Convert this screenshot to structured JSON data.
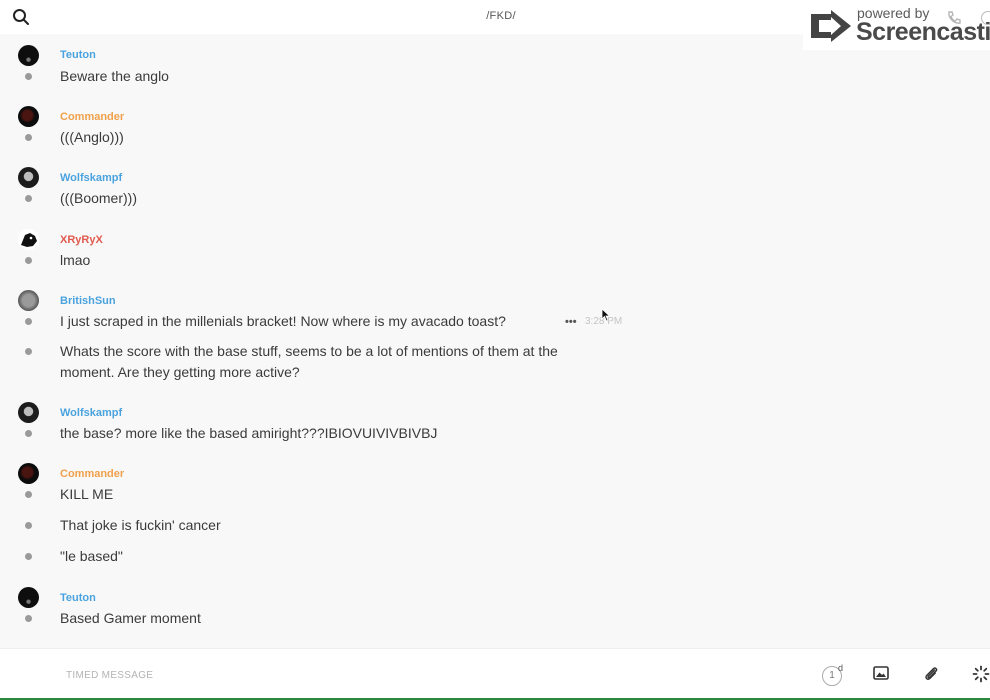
{
  "header": {
    "channel_title": "/FKD/",
    "search_icon": "search-icon"
  },
  "watermark": {
    "powered_by": "powered by",
    "brand": "Screencastify"
  },
  "messages": [
    {
      "user": "Teuton",
      "user_color": "#4aa3df",
      "avatar": "teuton",
      "lines": [
        "Beware the anglo"
      ]
    },
    {
      "user": "Commander",
      "user_color": "#f0a04b",
      "avatar": "commander",
      "lines": [
        "(((Anglo)))"
      ]
    },
    {
      "user": "Wolfskampf",
      "user_color": "#4aa3df",
      "avatar": "wolf",
      "lines": [
        "(((Boomer)))"
      ]
    },
    {
      "user": "XRyRyX",
      "user_color": "#e05a4f",
      "avatar": "xry",
      "lines": [
        "lmao"
      ]
    },
    {
      "user": "BritishSun",
      "user_color": "#4aa3df",
      "avatar": "brit",
      "lines": [
        "I just scraped in the millenials bracket!  Now where is my avacado toast?",
        "Whats the score with the base stuff, seems to be a lot of mentions of them at the moment.  Are they getting more active?"
      ],
      "hover_time": "3:28 PM",
      "more_label": "•••"
    },
    {
      "user": "Wolfskampf",
      "user_color": "#4aa3df",
      "avatar": "wolf",
      "lines": [
        "the base? more like the based amiright???IBIOVUIVIVBIVBJ"
      ]
    },
    {
      "user": "Commander",
      "user_color": "#f0a04b",
      "avatar": "commander",
      "lines": [
        "KILL ME",
        "That joke is fuckin' cancer",
        "\"le based\""
      ]
    },
    {
      "user": "Teuton",
      "user_color": "#4aa3df",
      "avatar": "teuton",
      "lines": [
        "Based Gamer moment"
      ]
    }
  ],
  "composer": {
    "placeholder": "TIMED MESSAGE",
    "timer_value": "1",
    "timer_unit": "d"
  }
}
